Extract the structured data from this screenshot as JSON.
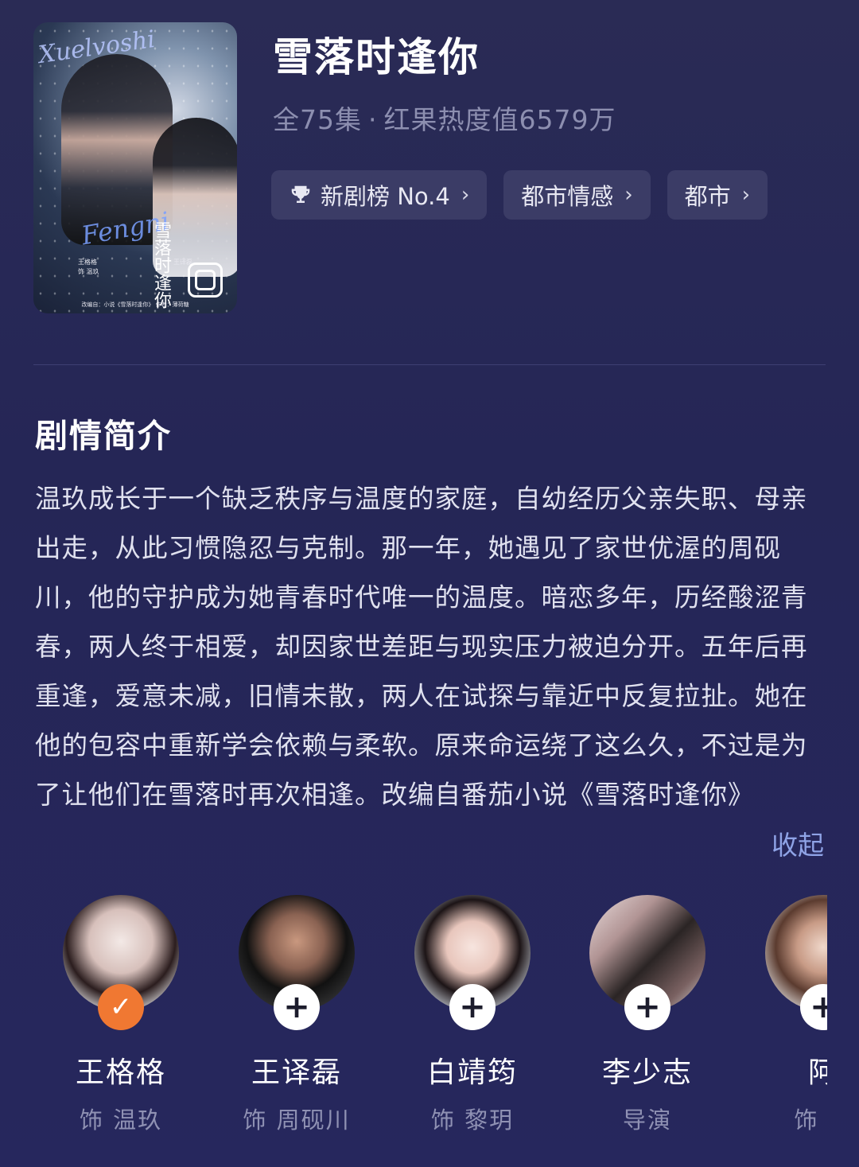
{
  "poster": {
    "script_top": "Xuelvoshi",
    "script_bottom": "Fengni",
    "cn_title": "雪落时逢你",
    "credit_left": "王格格",
    "credit_left_role": "饰 温玖",
    "credit_right": "王译磊",
    "footer": "改编自：小说《雪落时逢你》 作者：薄荷糖"
  },
  "drama": {
    "title": "雪落时逢你",
    "episodes": "全75集",
    "separator": "·",
    "heat": "红果热度值6579万"
  },
  "tags": [
    {
      "label": "新剧榜 No.4",
      "icon": "trophy-icon"
    },
    {
      "label": "都市情感"
    },
    {
      "label": "都市"
    }
  ],
  "synopsis": {
    "heading": "剧情简介",
    "text": "温玖成长于一个缺乏秩序与温度的家庭，自幼经历父亲失职、母亲出走，从此习惯隐忍与克制。那一年，她遇见了家世优渥的周砚川，他的守护成为她青春时代唯一的温度。暗恋多年，历经酸涩青春，两人终于相爱，却因家世差距与现实压力被迫分开。五年后再重逢，爱意未减，旧情未散，两人在试探与靠近中反复拉扯。她在他的包容中重新学会依赖与柔软。原来命运绕了这么久，不过是为了让他们在雪落时再次相逢。改编自番茄小说《雪落时逢你》",
    "collapse": "收起"
  },
  "cast": [
    {
      "name": "王格格",
      "role": "饰 温玖",
      "followed": true
    },
    {
      "name": "王译磊",
      "role": "饰 周砚川",
      "followed": false
    },
    {
      "name": "白靖筠",
      "role": "饰 黎玥",
      "followed": false
    },
    {
      "name": "李少志",
      "role": "导演",
      "followed": false
    },
    {
      "name": "阿",
      "role": "饰 材",
      "followed": false
    }
  ],
  "icons": {
    "chevron": "›",
    "plus": "+",
    "check": "✓"
  },
  "colors": {
    "background": "#26275a",
    "tag_bg": "#3b3c66",
    "accent_orange": "#f07832",
    "link": "#8fa3e6"
  }
}
